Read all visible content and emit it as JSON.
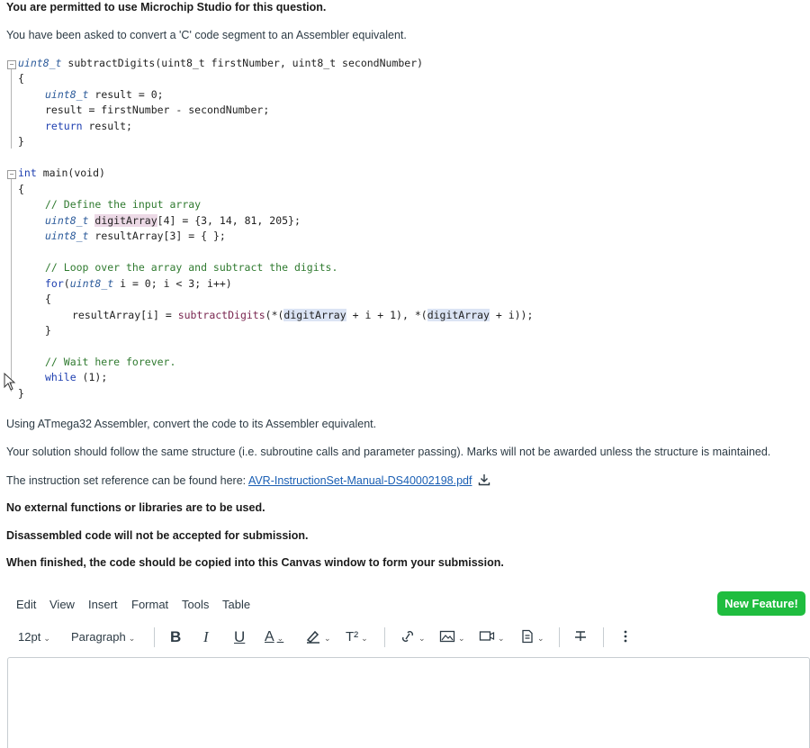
{
  "question": {
    "permission": "You are permitted to use Microchip Studio for this question.",
    "intro": "You have been asked to convert a 'C' code segment to an Assembler equivalent.",
    "instruction1": "Using ATmega32 Assembler, convert the code to its Assembler equivalent.",
    "instruction2": "Your solution should follow the same structure (i.e. subroutine calls and parameter passing). Marks will not be awarded unless the structure is maintained.",
    "reference_prefix": "The instruction set reference can be found here:",
    "reference_link": "AVR-InstructionSet-Manual-DS40002198.pdf",
    "rule1": "No external functions or libraries are to be used.",
    "rule2": "Disassembled code will not be accepted for submission.",
    "rule3": "When finished, the code should be copied into this Canvas window to form your submission."
  },
  "code": {
    "fn_type": "uint8_t",
    "fn_name": "subtractDigits",
    "fn_params": "(uint8_t firstNumber, uint8_t secondNumber)",
    "l2": "{",
    "l3_type": "uint8_t",
    "l3_rest": " result = 0;",
    "l4": "result = firstNumber - secondNumber;",
    "l5_kw": "return",
    "l5_rest": " result;",
    "l6": "}",
    "m1_type": "int",
    "m1_rest": " main(void)",
    "m2": "{",
    "m3": "// Define the input array",
    "m4_type": "uint8_t",
    "m4_name": "digitArray",
    "m4_rest": "[4] = {3, 14, 81, 205};",
    "m5_type": "uint8_t",
    "m5_rest": " resultArray[3] = { };",
    "m6": "// Loop over the array and subtract the digits.",
    "m7_kw": "for",
    "m7_open": "(",
    "m7_type": "uint8_t",
    "m7_rest": " i = 0; i < 3; i++)",
    "m8": "{",
    "m9_a": "resultArray[i] = ",
    "m9_fn": "subtractDigits",
    "m9_b": "(*(",
    "m9_arr1": "digitArray",
    "m9_c": " + i + 1), *(",
    "m9_arr2": "digitArray",
    "m9_d": " + i));",
    "m10": "}",
    "m11": "// Wait here forever.",
    "m12_kw": "while",
    "m12_rest": " (1);",
    "m13": "}"
  },
  "menubar": [
    "Edit",
    "View",
    "Insert",
    "Format",
    "Tools",
    "Table"
  ],
  "new_feature": "New Feature!",
  "toolbar": {
    "font_size": "12pt",
    "block": "Paragraph",
    "bold": "B",
    "italic": "I",
    "underline": "U",
    "text_color": "A",
    "superscript": "T²"
  },
  "icons": [
    "download-icon",
    "chevron-down-icon",
    "link-icon",
    "image-icon",
    "media-icon",
    "document-icon",
    "clear-format-icon",
    "more-icon",
    "mouse-pointer-icon"
  ]
}
